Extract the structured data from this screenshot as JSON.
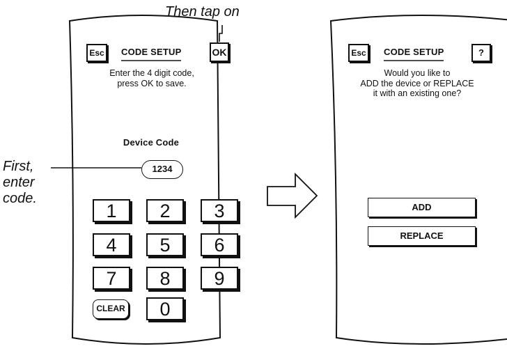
{
  "callouts": {
    "then_tap_on": "Then tap on",
    "first_enter_code": [
      "First,",
      "enter",
      "code."
    ]
  },
  "screen1": {
    "esc_label": "Esc",
    "title": "CODE SETUP",
    "ok_label": "OK",
    "instruction": [
      "Enter the 4 digit code,",
      "press OK to save."
    ],
    "device_code_label": "Device Code",
    "device_code_value": "1234",
    "keypad": [
      "1",
      "2",
      "3",
      "4",
      "5",
      "6",
      "7",
      "8",
      "9"
    ],
    "clear_label": "CLEAR",
    "zero_label": "0"
  },
  "screen2": {
    "esc_label": "Esc",
    "title": "CODE SETUP",
    "help_label": "?",
    "question": [
      "Would you like to",
      "ADD the device or REPLACE",
      "it with an existing one?"
    ],
    "add_label": "ADD",
    "replace_label": "REPLACE"
  }
}
